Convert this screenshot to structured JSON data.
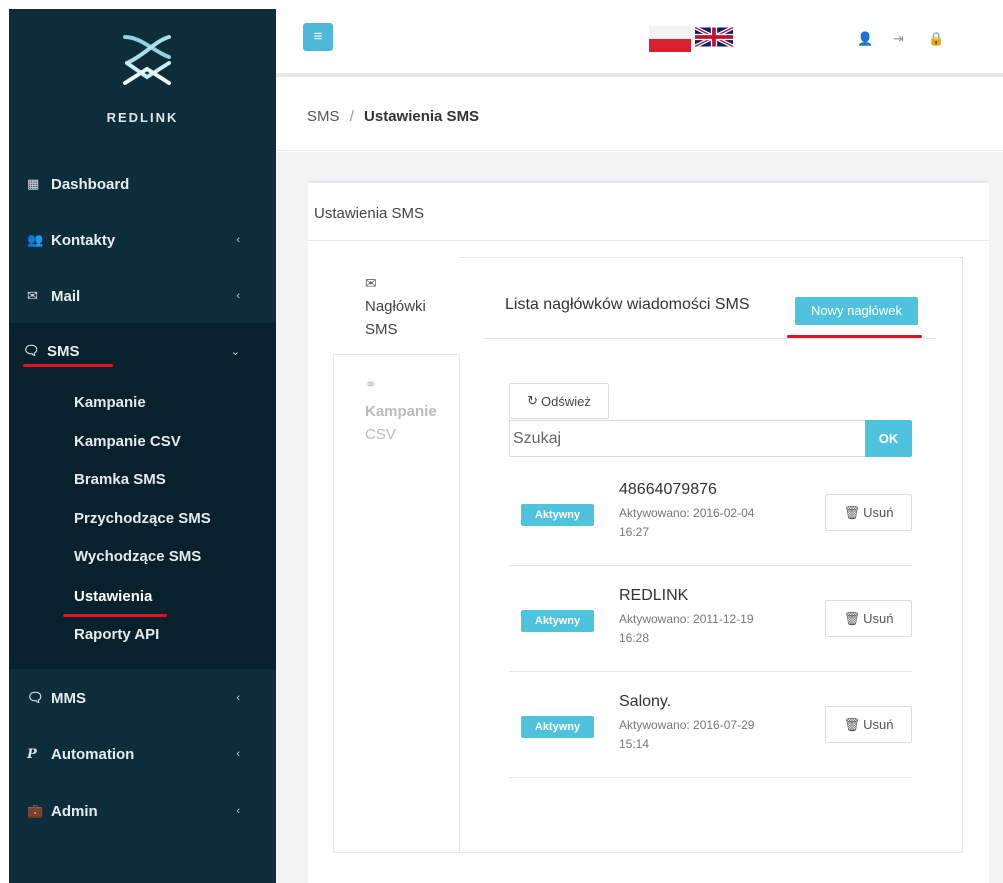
{
  "brand": {
    "name": "REDLINK"
  },
  "sidebar": {
    "items": [
      {
        "label": "Dashboard",
        "icon": "dashboard-icon"
      },
      {
        "label": "Kontakty",
        "icon": "users-icon"
      },
      {
        "label": "Mail",
        "icon": "envelope-icon"
      },
      {
        "label": "SMS",
        "icon": "chat-icon"
      },
      {
        "label": "MMS",
        "icon": "chat-icon"
      },
      {
        "label": "Automation",
        "icon": "automation-icon"
      },
      {
        "label": "Admin",
        "icon": "briefcase-icon"
      }
    ],
    "sms_sub": [
      "Kampanie",
      "Kampanie CSV",
      "Bramka SMS",
      "Przychodzące SMS",
      "Wychodzące SMS",
      "Ustawienia",
      "Raporty API"
    ]
  },
  "header": {
    "menu_icon": "hamburger-icon",
    "languages": [
      "pl-flag",
      "uk-flag"
    ],
    "icons": [
      "user-icon",
      "sign-out-icon",
      "lock-icon"
    ]
  },
  "breadcrumb": {
    "parent": "SMS",
    "separator": "/",
    "current": "Ustawienia SMS"
  },
  "panel": {
    "title": "Ustawienia SMS"
  },
  "tabs": [
    {
      "label_line1": "Nagłówki",
      "label_line2": "SMS",
      "icon": "envelope-icon",
      "active": true
    },
    {
      "label_line1": "Kampanie",
      "label_line2": "CSV",
      "icon": "link-icon",
      "active": false
    }
  ],
  "list": {
    "title": "Lista nagłówków wiadomości SMS",
    "new_button": "Nowy nagłówek",
    "refresh_button": "Odśwież",
    "search_placeholder": "Szukaj",
    "ok_button": "OK",
    "rows": [
      {
        "status": "Aktywny",
        "name": "48664079876",
        "date_line1": "Aktywowano: 2016-02-04",
        "date_line2": "16:27",
        "delete": "Usuń"
      },
      {
        "status": "Aktywny",
        "name": "REDLINK",
        "date_line1": "Aktywowano: 2011-12-19",
        "date_line2": "16:28",
        "delete": "Usuń"
      },
      {
        "status": "Aktywny",
        "name": "Salony.",
        "date_line1": "Aktywowano: 2016-07-29",
        "date_line2": "15:14",
        "delete": "Usuń"
      }
    ]
  },
  "colors": {
    "sidebar": "#0e2d3b",
    "sidebar_active": "#08212c",
    "accent": "#4fc3dd",
    "highlight": "#e0141c"
  }
}
